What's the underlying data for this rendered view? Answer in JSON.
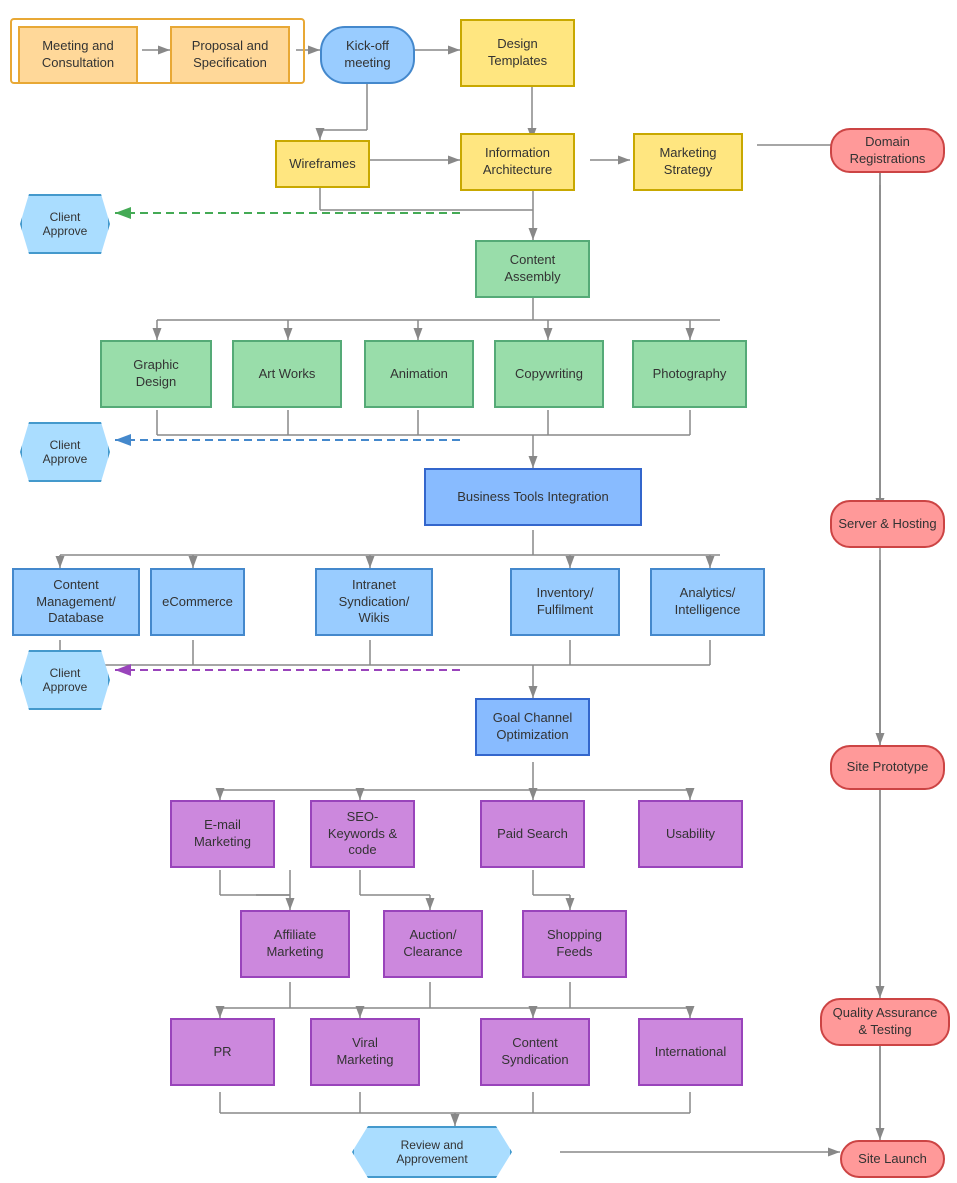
{
  "nodes": {
    "meeting": {
      "label": "Meeting and\nConsultation"
    },
    "proposal": {
      "label": "Proposal and\nSpecification"
    },
    "kickoff": {
      "label": "Kick-off\nmeeting"
    },
    "design_templates": {
      "label": "Design\nTemplates"
    },
    "wireframes": {
      "label": "Wireframes"
    },
    "info_arch": {
      "label": "Information\nArchitecture"
    },
    "marketing": {
      "label": "Marketing\nStrategy"
    },
    "domain": {
      "label": "Domain\nRegistrations"
    },
    "client_approve_1": {
      "label": "Client\nApprove"
    },
    "content_assembly": {
      "label": "Content\nAssembly"
    },
    "graphic_design": {
      "label": "Graphic\nDesign"
    },
    "art_works": {
      "label": "Art Works"
    },
    "animation": {
      "label": "Animation"
    },
    "copywriting": {
      "label": "Copywriting"
    },
    "photography": {
      "label": "Photography"
    },
    "client_approve_2": {
      "label": "Client\nApprove"
    },
    "biz_tools": {
      "label": "Business Tools Integration"
    },
    "server": {
      "label": "Server & Hosting"
    },
    "content_mgmt": {
      "label": "Content Management/\nDatabase"
    },
    "ecommerce": {
      "label": "eCommerce"
    },
    "intranet": {
      "label": "Intranet Syndication/\nWikis"
    },
    "inventory": {
      "label": "Inventory/\nFulfilment"
    },
    "analytics": {
      "label": "Analytics/\nIntelligence"
    },
    "client_approve_3": {
      "label": "Client\nApprove"
    },
    "goal_channel": {
      "label": "Goal Channel\nOptimization"
    },
    "site_prototype": {
      "label": "Site Prototype"
    },
    "email_marketing": {
      "label": "E-mail\nMarketing"
    },
    "seo": {
      "label": "SEO-\nKeywords &\ncode"
    },
    "paid_search": {
      "label": "Paid Search"
    },
    "usability": {
      "label": "Usability"
    },
    "affiliate": {
      "label": "Affiliate\nMarketing"
    },
    "auction": {
      "label": "Auction/\nClearance"
    },
    "shopping_feeds": {
      "label": "Shopping\nFeeds"
    },
    "pr": {
      "label": "PR"
    },
    "viral": {
      "label": "Viral\nMarketing"
    },
    "content_syndication": {
      "label": "Content\nSyndication"
    },
    "international": {
      "label": "International"
    },
    "qa": {
      "label": "Quality Assurance\n& Testing"
    },
    "review": {
      "label": "Review and\nApprovement"
    },
    "site_launch": {
      "label": "Site Launch"
    }
  }
}
